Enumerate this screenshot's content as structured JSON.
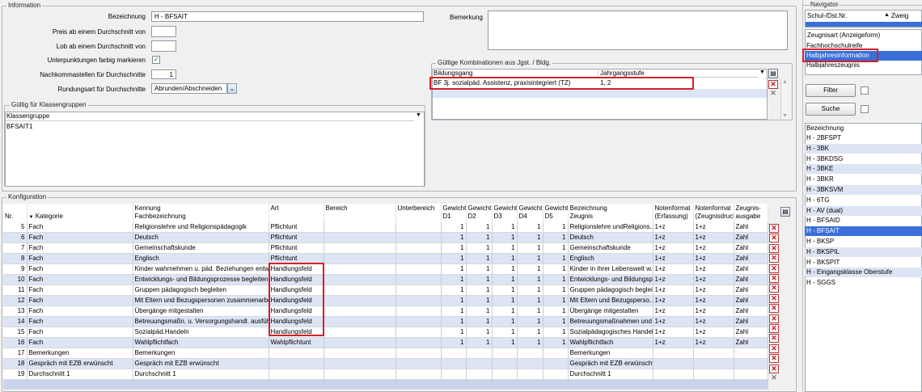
{
  "information": {
    "legend": "Information",
    "bezeichnung_label": "Bezeichnung",
    "bezeichnung_value": "H - BFSAIT",
    "preis_label": "Preis ab einem Durchschnitt von",
    "preis_value": "",
    "lob_label": "Lob ab einem Durchschnitt von",
    "lob_value": "",
    "unterpunktungen_label": "Unterpunktungen farbig markieren",
    "unterpunktungen_checked": "✓",
    "nachkomma_label": "Nachkommastellen für Durchschnitte",
    "nachkomma_value": "1",
    "rundung_label": "Rundungsart für Durchschnitte",
    "rundung_value": "Abrunden/Abschneiden",
    "bemerkung_label": "Bemerkung",
    "bemerkung_value": ""
  },
  "klassengruppen": {
    "legend": "Gültig für Klassengruppen",
    "header": "Klassengruppe",
    "items": [
      "BFSAIT1"
    ]
  },
  "kombinationen": {
    "legend": "Gültige Kombinationen aus Jgst. / Bldg.",
    "col_bildungsgang": "Bildungsgang",
    "col_jahrgangsstufe": "Jahrgangsstufe",
    "row": {
      "bildungsgang": "BF 3j. sozialpäd. Assistenz, praxisintegriert (TZ)",
      "jahrgangsstufe": "1, 2"
    }
  },
  "konfiguration": {
    "legend": "Konfiguration",
    "headers": {
      "nr": "Nr.",
      "kategorie": "Kategorie",
      "kennung": "Kennung",
      "fach_bez": "Fachbezeichnung",
      "art": "Art",
      "bereich": "Bereich",
      "unterbereich": "Unterbereich",
      "g1a": "Gewicht",
      "g1b": "D1",
      "g2a": "Gewicht",
      "g2b": "D2",
      "g3a": "Gewicht",
      "g3b": "D3",
      "g4a": "Gewicht",
      "g4b": "D4",
      "g5a": "Gewicht",
      "g5b": "D5",
      "bez": "Bezeichnung",
      "zeugnis": "Zeugnis",
      "nf1a": "Notenformat",
      "nf1b": "(Erfassung)",
      "nf2a": "Notenformat",
      "nf2b": "(Zeugnisdruck)",
      "za": "Zeugnis-",
      "zb": "ausgabe"
    },
    "rows": [
      {
        "nr": "5",
        "kat": "Fach",
        "kennung": "Religionslehre und Religionspädagogik",
        "art": "Pflichtunt",
        "bereich": "",
        "unter": "",
        "d1": "1",
        "d2": "1",
        "d3": "1",
        "d4": "1",
        "d5": "1",
        "zeugnis": "Religionslehre undReligions...",
        "nf1": "1+z",
        "nf2": "1+z",
        "za": "Zahl"
      },
      {
        "nr": "6",
        "kat": "Fach",
        "kennung": "Deutsch",
        "art": "Pflichtunt",
        "bereich": "",
        "unter": "",
        "d1": "1",
        "d2": "1",
        "d3": "1",
        "d4": "1",
        "d5": "1",
        "zeugnis": "Deutsch",
        "nf1": "1+z",
        "nf2": "1+z",
        "za": "Zahl"
      },
      {
        "nr": "7",
        "kat": "Fach",
        "kennung": "Gemeinschaftskunde",
        "art": "Pflichtunt",
        "bereich": "",
        "unter": "",
        "d1": "1",
        "d2": "1",
        "d3": "1",
        "d4": "1",
        "d5": "1",
        "zeugnis": "Gemeinschaftskunde",
        "nf1": "1+z",
        "nf2": "1+z",
        "za": "Zahl"
      },
      {
        "nr": "8",
        "kat": "Fach",
        "kennung": "Englisch",
        "art": "Pflichtunt",
        "bereich": "",
        "unter": "",
        "d1": "1",
        "d2": "1",
        "d3": "1",
        "d4": "1",
        "d5": "1",
        "zeugnis": "Englisch",
        "nf1": "1+z",
        "nf2": "1+z",
        "za": "Zahl"
      },
      {
        "nr": "9",
        "kat": "Fach",
        "kennung": "Kinder wahrnehmen u. päd. Beziehungen entwi...",
        "art": "Handlungsfeld",
        "bereich": "",
        "unter": "",
        "d1": "1",
        "d2": "1",
        "d3": "1",
        "d4": "1",
        "d5": "1",
        "zeugnis": "Kinder in ihrer Lebenswelt w...",
        "nf1": "1+z",
        "nf2": "1+z",
        "za": "Zahl"
      },
      {
        "nr": "10",
        "kat": "Fach",
        "kennung": "Entwicklungs- und Bildungsprozesse begleiten I",
        "art": "Handlungsfeld",
        "bereich": "",
        "unter": "",
        "d1": "1",
        "d2": "1",
        "d3": "1",
        "d4": "1",
        "d5": "1",
        "zeugnis": "Entwicklungs- und Bildungspr...",
        "nf1": "1+z",
        "nf2": "1+z",
        "za": "Zahl"
      },
      {
        "nr": "11",
        "kat": "Fach",
        "kennung": "Gruppen pädagogisch begleiten",
        "art": "Handlungsfeld",
        "bereich": "",
        "unter": "",
        "d1": "1",
        "d2": "1",
        "d3": "1",
        "d4": "1",
        "d5": "1",
        "zeugnis": "Gruppen pädagogisch beglei...",
        "nf1": "1+z",
        "nf2": "1+z",
        "za": "Zahl"
      },
      {
        "nr": "12",
        "kat": "Fach",
        "kennung": "Mit Eltern und Bezugspersonen zusammenarbe...",
        "art": "Handlungsfeld",
        "bereich": "",
        "unter": "",
        "d1": "1",
        "d2": "1",
        "d3": "1",
        "d4": "1",
        "d5": "1",
        "zeugnis": "Mit Eltern und Bezugsperso...",
        "nf1": "1+z",
        "nf2": "1+z",
        "za": "Zahl"
      },
      {
        "nr": "13",
        "kat": "Fach",
        "kennung": "Übergänge mitgestalten",
        "art": "Handlungsfeld",
        "bereich": "",
        "unter": "",
        "d1": "1",
        "d2": "1",
        "d3": "1",
        "d4": "1",
        "d5": "1",
        "zeugnis": "Übergänge mitgestalten",
        "nf1": "1+z",
        "nf2": "1+z",
        "za": "Zahl"
      },
      {
        "nr": "14",
        "kat": "Fach",
        "kennung": "Betreuungsmaßn. u. Versorgungshandl. ausfüh...",
        "art": "Handlungsfeld",
        "bereich": "",
        "unter": "",
        "d1": "1",
        "d2": "1",
        "d3": "1",
        "d4": "1",
        "d5": "1",
        "zeugnis": "Betreuungsmaßnahmen und ...",
        "nf1": "1+z",
        "nf2": "1+z",
        "za": "Zahl"
      },
      {
        "nr": "15",
        "kat": "Fach",
        "kennung": "Sozialpäd.Handeln",
        "art": "Handlungsfeld",
        "bereich": "",
        "unter": "",
        "d1": "1",
        "d2": "1",
        "d3": "1",
        "d4": "1",
        "d5": "1",
        "zeugnis": "Sozialpädagogisches Handeln",
        "nf1": "1+z",
        "nf2": "1+z",
        "za": "Zahl"
      },
      {
        "nr": "16",
        "kat": "Fach",
        "kennung": "Wahlpflichtfach",
        "art": "Wahlpflichtunt",
        "bereich": "",
        "unter": "",
        "d1": "1",
        "d2": "1",
        "d3": "1",
        "d4": "1",
        "d5": "1",
        "zeugnis": "Wahlpflichtfach",
        "nf1": "1+z",
        "nf2": "1+z",
        "za": "Zahl"
      },
      {
        "nr": "17",
        "kat": "Bemerkungen",
        "kennung": "Bemerkungen",
        "art": "",
        "bereich": "",
        "unter": "",
        "d1": "",
        "d2": "",
        "d3": "",
        "d4": "",
        "d5": "",
        "zeugnis": "Bemerkungen",
        "nf1": "",
        "nf2": "",
        "za": ""
      },
      {
        "nr": "18",
        "kat": "Gespräch mit EZB erwünscht",
        "kennung": "Gespräch mit EZB erwünscht",
        "art": "",
        "bereich": "",
        "unter": "",
        "d1": "",
        "d2": "",
        "d3": "",
        "d4": "",
        "d5": "",
        "zeugnis": "Gespräch mit EZB erwünscht",
        "nf1": "",
        "nf2": "",
        "za": ""
      },
      {
        "nr": "19",
        "kat": "Durchschnitt 1",
        "kennung": "Durchschnitt 1",
        "art": "",
        "bereich": "",
        "unter": "",
        "d1": "",
        "d2": "",
        "d3": "",
        "d4": "",
        "d5": "",
        "zeugnis": "Durchschnitt 1",
        "nf1": "",
        "nf2": "",
        "za": ""
      }
    ]
  },
  "navigator": {
    "legend": "Navigator",
    "col_schul": "Schul-/Dst.Nr.",
    "col_zweig": "Zweig",
    "zeugnisart_label": "Zeugnisart (Anzeigeform)",
    "zeugnisarten": [
      "Fachhochschulreife",
      "Halbjahresinformation",
      "Halbjahreszeugnis"
    ],
    "filter_button": "Filter",
    "suche_button": "Suche",
    "bez_header": "Bezeichnung",
    "items": [
      "H - 2BFSPT",
      "H - 3BK",
      "H - 3BKDSG",
      "H - 3BKE",
      "H - 3BKR",
      "H - 3BKSVM",
      "H - 6TG",
      "H - AV (dual)",
      "H - BFSAID",
      "H - BFSAIT",
      "H - BKSP",
      "H - BKSPIL",
      "H - BKSPIT",
      "H - Eingangsklasse Oberstufe",
      "H - SGGS"
    ],
    "selected_item": "H - BFSAIT"
  },
  "colors": {
    "highlight_red": "#d4202a",
    "selection_blue": "#3a6fd8",
    "row_alt": "#dde4f3"
  }
}
